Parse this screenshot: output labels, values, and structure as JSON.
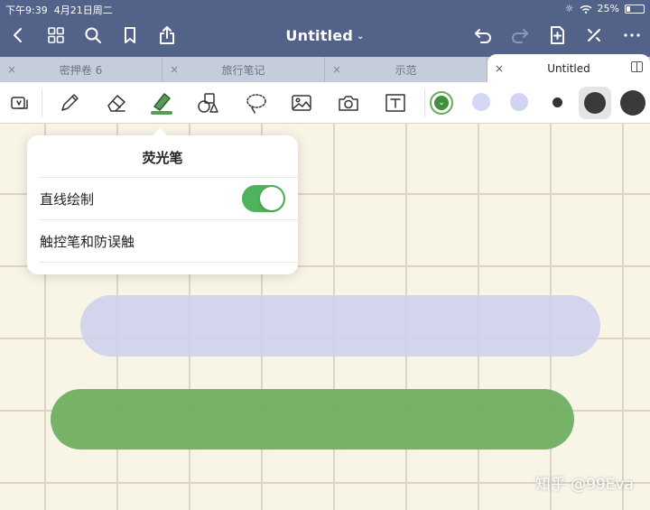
{
  "status": {
    "time": "下午9:39",
    "date": "4月21日周二",
    "battery": "25%"
  },
  "document": {
    "title": "Untitled"
  },
  "tabs": [
    {
      "label": "密押卷 6",
      "active": false
    },
    {
      "label": "旅行笔记",
      "active": false
    },
    {
      "label": "示范",
      "active": false
    },
    {
      "label": "Untitled",
      "active": true
    }
  ],
  "colors": {
    "nav_bg": "#536288",
    "highlighter_green": "#6aac5e",
    "highlighter_lavender": "#cdd1ec",
    "swatch_lavender_1": "#d4d6f3",
    "swatch_lavender_2": "#d1d4f1",
    "swatch_dark": "#3a3a3a"
  },
  "popover": {
    "title": "荧光笔",
    "rows": [
      {
        "label": "直线绘制",
        "toggle": true
      },
      {
        "label": "触控笔和防误触"
      }
    ]
  },
  "watermark": "知乎 @99Eva"
}
